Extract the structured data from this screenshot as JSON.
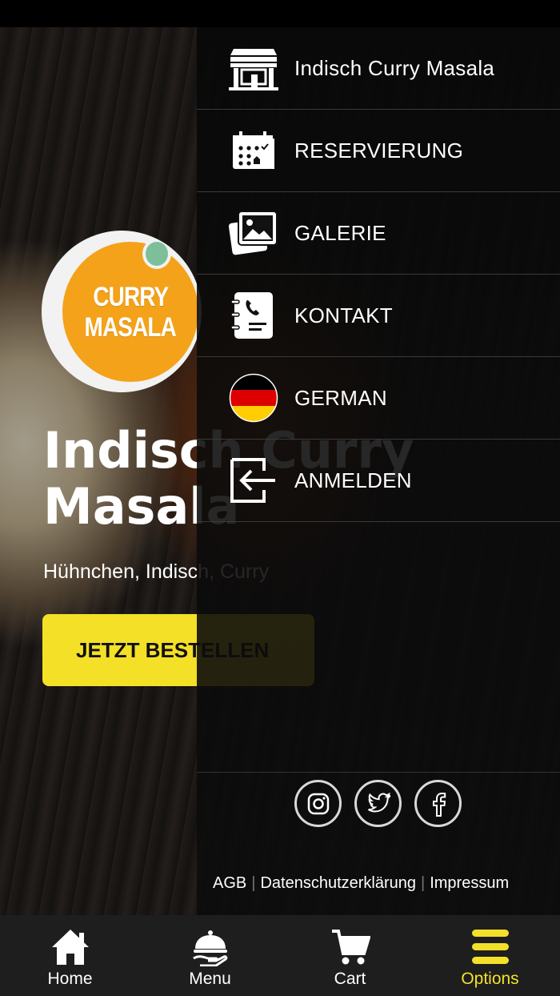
{
  "hero": {
    "logo_line1": "CURRY",
    "logo_line2": "MASALA",
    "title": "Indisch Curry Masala",
    "subtitle": "Hühnchen, Indisch, Curry",
    "order_button": "JETZT BESTELLEN"
  },
  "drawer": {
    "items": [
      {
        "label": "Indisch Curry Masala",
        "icon": "restaurant-icon"
      },
      {
        "label": "RESERVIERUNG",
        "icon": "calendar-icon"
      },
      {
        "label": "GALERIE",
        "icon": "gallery-icon"
      },
      {
        "label": "KONTAKT",
        "icon": "contact-book-icon"
      },
      {
        "label": "GERMAN",
        "icon": "german-flag-icon"
      },
      {
        "label": "ANMELDEN",
        "icon": "login-icon"
      }
    ],
    "social": [
      "instagram-icon",
      "twitter-icon",
      "facebook-icon"
    ],
    "legal": {
      "agb": "AGB",
      "privacy": "Datenschutzerklärung",
      "imprint": "Impressum"
    }
  },
  "tabbar": {
    "tabs": [
      {
        "label": "Home",
        "icon": "home-icon"
      },
      {
        "label": "Menu",
        "icon": "cloche-icon"
      },
      {
        "label": "Cart",
        "icon": "cart-icon"
      },
      {
        "label": "Options",
        "icon": "menu-bars-icon"
      }
    ],
    "active_index": 3,
    "active_color": "#f2e12a"
  },
  "colors": {
    "accent": "#f4e026",
    "logo_orange": "#f4a21a",
    "logo_dot": "#7dbf9a"
  }
}
